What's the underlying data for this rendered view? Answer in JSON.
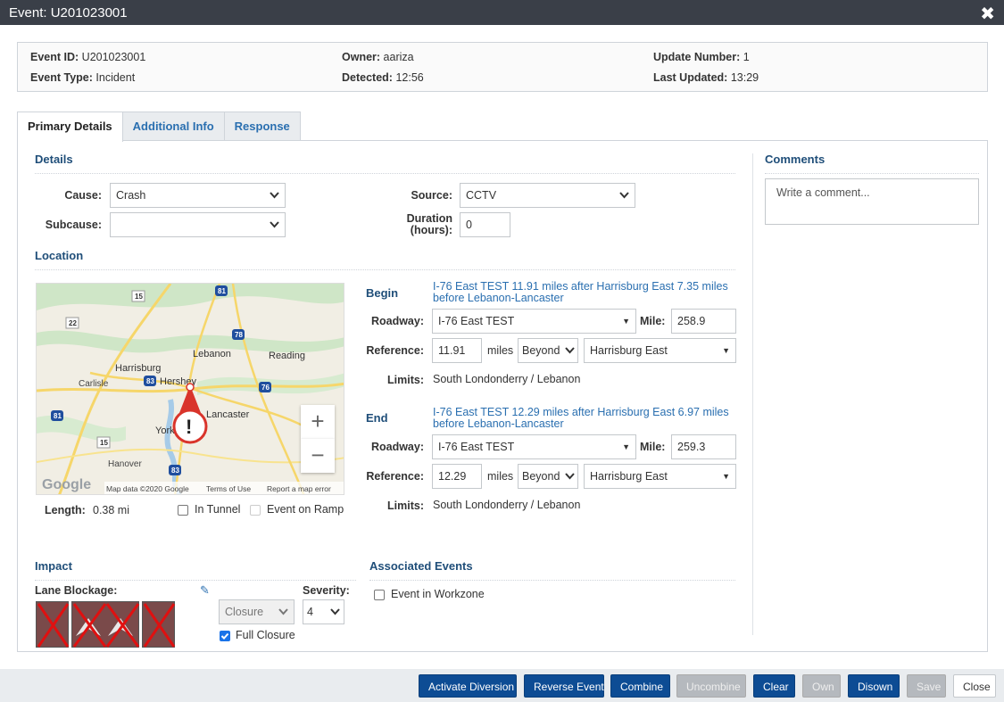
{
  "window": {
    "title": "Event: U201023001"
  },
  "summary": {
    "event_id_label": "Event ID:",
    "event_id": "U201023001",
    "event_type_label": "Event Type:",
    "event_type": "Incident",
    "owner_label": "Owner:",
    "owner": "aariza",
    "detected_label": "Detected:",
    "detected": "12:56",
    "update_number_label": "Update Number:",
    "update_number": "1",
    "last_updated_label": "Last Updated:",
    "last_updated": "13:29"
  },
  "tabs": [
    "Primary Details",
    "Additional Info",
    "Response"
  ],
  "details": {
    "title": "Details",
    "cause_label": "Cause:",
    "cause": "Crash",
    "subcause_label": "Subcause:",
    "subcause": "",
    "source_label": "Source:",
    "source": "CCTV",
    "duration_label_1": "Duration",
    "duration_label_2": "(hours):",
    "duration": "0"
  },
  "location": {
    "title": "Location",
    "map": {
      "places": [
        "Harrisburg",
        "Hershey",
        "Lebanon",
        "Reading",
        "Carlisle",
        "Lancaster",
        "York",
        "Hanover"
      ],
      "route_shields": [
        "15",
        "81",
        "22",
        "78",
        "76",
        "81",
        "15",
        "83",
        "83"
      ],
      "google_logo": "Google",
      "attribution": [
        "Map data ©2020 Google",
        "Terms of Use",
        "Report a map error"
      ],
      "zoom_in": "+",
      "zoom_out": "−"
    },
    "length_label": "Length:",
    "length": "0.38 mi",
    "in_tunnel": "In Tunnel",
    "event_on_ramp": "Event on Ramp",
    "begin": {
      "title": "Begin",
      "description": "I-76 East TEST 11.91 miles after Harrisburg East 7.35 miles before Lebanon-Lancaster",
      "roadway_label": "Roadway:",
      "roadway": "I-76 East TEST",
      "mile_label": "Mile:",
      "mile": "258.9",
      "reference_label": "Reference:",
      "reference": "11.91",
      "miles": "miles",
      "direction": "Beyond",
      "ref_point": "Harrisburg East",
      "limits_label": "Limits:",
      "limits": "South Londonderry / Lebanon"
    },
    "end": {
      "title": "End",
      "description": "I-76 East TEST 12.29 miles after Harrisburg East 6.97 miles before Lebanon-Lancaster",
      "roadway_label": "Roadway:",
      "roadway": "I-76 East TEST",
      "mile_label": "Mile:",
      "mile": "259.3",
      "reference_label": "Reference:",
      "reference": "12.29",
      "miles": "miles",
      "direction": "Beyond",
      "ref_point": "Harrisburg East",
      "limits_label": "Limits:",
      "limits": "South Londonderry / Lebanon"
    }
  },
  "impact": {
    "title": "Impact",
    "lane_blockage_label": "Lane Blockage:",
    "closure": "Closure",
    "severity_label": "Severity:",
    "severity": "4",
    "full_closure": "Full Closure",
    "full_closure_checked": true
  },
  "associated": {
    "title": "Associated Events",
    "event_in_workzone": "Event in Workzone"
  },
  "comments": {
    "title": "Comments",
    "placeholder": "Write a comment..."
  },
  "footer": {
    "activate_diversion": "Activate Diversion",
    "reverse_event": "Reverse Event",
    "combine": "Combine",
    "uncombine": "Uncombine",
    "clear": "Clear",
    "own": "Own",
    "disown": "Disown",
    "save": "Save",
    "close": "Close"
  },
  "colors": {
    "title_bar": "#3a3f48",
    "primary_button": "#0d4c94",
    "link": "#2a6fb0",
    "section_title": "#1f4e79"
  }
}
